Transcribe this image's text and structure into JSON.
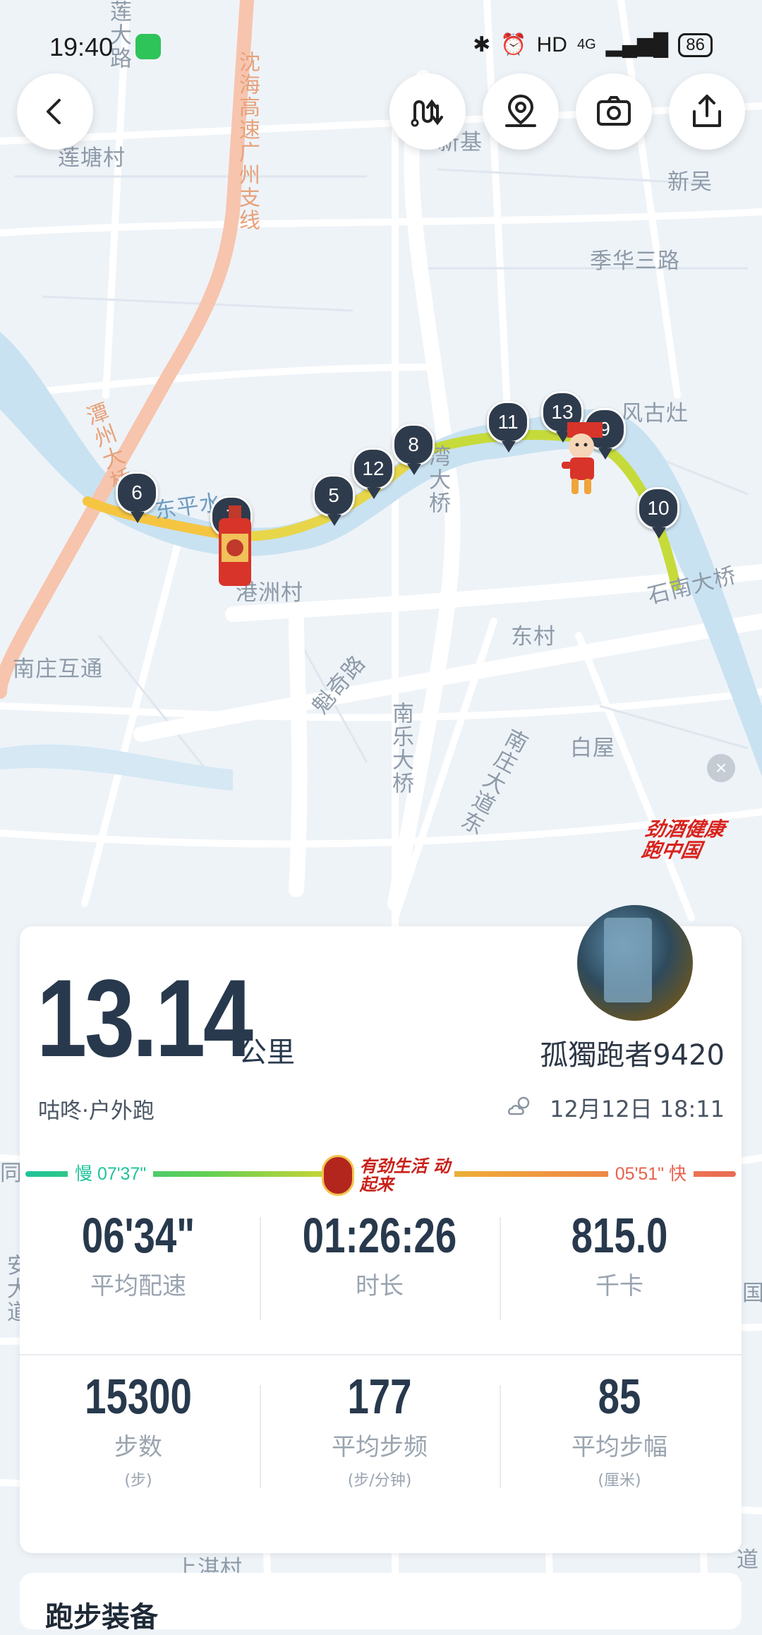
{
  "status_bar": {
    "time": "19:40",
    "network": "HD",
    "signal": "4G",
    "battery": "86"
  },
  "map": {
    "labels": [
      {
        "id": "lianda-road",
        "text": "莲大路"
      },
      {
        "id": "liantang-village",
        "text": "莲塘村"
      },
      {
        "id": "shenhai-expressway",
        "text": "沈海高速广州支线"
      },
      {
        "id": "xinji",
        "text": "新基"
      },
      {
        "id": "xinwu",
        "text": "新吴"
      },
      {
        "id": "jihua-3rd-road",
        "text": "季华三路"
      },
      {
        "id": "fenggu-zao",
        "text": "风古灶"
      },
      {
        "id": "tanzhou-bridge",
        "text": "潭州大桥"
      },
      {
        "id": "dongping-water",
        "text": "东平水"
      },
      {
        "id": "gangzhou-village",
        "text": "港洲村"
      },
      {
        "id": "bridge-mid",
        "text": "湾大桥"
      },
      {
        "id": "shinan-bridge",
        "text": "石南大桥"
      },
      {
        "id": "dong-village",
        "text": "东村"
      },
      {
        "id": "nanzhuang-interchange",
        "text": "南庄互通"
      },
      {
        "id": "kuiqi-road",
        "text": "魁奇路"
      },
      {
        "id": "nanle-bridge",
        "text": "南乐大桥"
      },
      {
        "id": "nanzhuang-avenue-east",
        "text": "南庄大道东"
      },
      {
        "id": "baiwu",
        "text": "白屋"
      },
      {
        "id": "shangqi-village",
        "text": "上淇村"
      },
      {
        "id": "edge-tong",
        "text": "同"
      },
      {
        "id": "edge-guo",
        "text": "国"
      },
      {
        "id": "edge-dao",
        "text": "道"
      },
      {
        "id": "edge-avenue",
        "text": "安大道"
      }
    ],
    "km_markers": [
      "6",
      "7",
      "5",
      "12",
      "8",
      "11",
      "13",
      "9",
      "10"
    ],
    "brand_logo": "劲酒健康跑中国",
    "route_colors": {
      "slow": "#f5c542",
      "mid": "#d9d84a",
      "fast": "#c6db3a"
    }
  },
  "toolbar": {
    "back_icon": "back-arrow-icon",
    "route_icon": "route-switch-icon",
    "pin_icon": "location-pin-icon",
    "camera_icon": "camera-icon",
    "share_icon": "share-icon"
  },
  "summary": {
    "distance": "13.14",
    "distance_unit": "公里",
    "username": "孤獨跑者9420",
    "run_type": "咕咚·户外跑",
    "datetime": "12月12日 18:11",
    "pace_bar": {
      "slow_label": "慢 07'37\"",
      "fast_label": "05'51\" 快",
      "slogan": "有劲生活 动起来"
    },
    "stats_row1": [
      {
        "value": "06'34\"",
        "label": "平均配速"
      },
      {
        "value": "01:26:26",
        "label": "时长"
      },
      {
        "value": "815.0",
        "label": "千卡"
      }
    ],
    "stats_row2": [
      {
        "value": "15300",
        "label": "步数",
        "unit": "(步)"
      },
      {
        "value": "177",
        "label": "平均步频",
        "unit": "(步/分钟)"
      },
      {
        "value": "85",
        "label": "平均步幅",
        "unit": "(厘米)"
      }
    ]
  },
  "next_section": {
    "title": "跑步装备"
  }
}
